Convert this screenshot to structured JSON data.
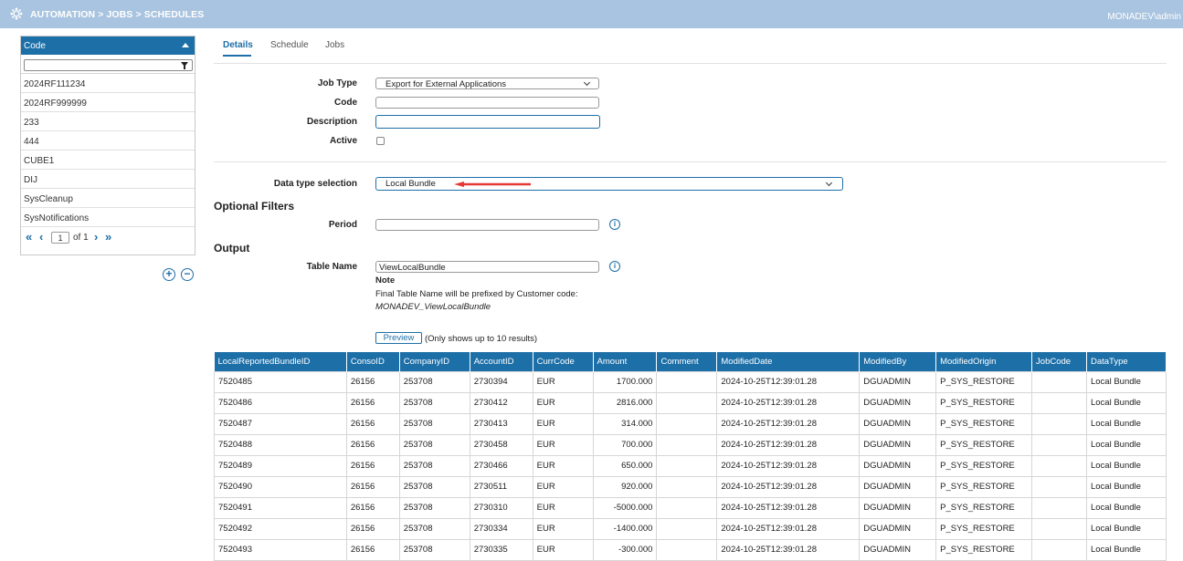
{
  "topbar": {
    "breadcrumb": "AUTOMATION > JOBS > SCHEDULES",
    "user": "MONADEV\\admin",
    "logo_icon": "gear-cluster-icon"
  },
  "sidebar": {
    "column_header": "Code",
    "filter_value": "",
    "items": [
      "2024RF111234",
      "2024RF999999",
      "233",
      "444",
      "CUBE1",
      "DIJ",
      "SysCleanup",
      "SysNotifications"
    ],
    "pager": {
      "current": "1",
      "of_label": "of",
      "total": "1"
    },
    "add_label": "+",
    "remove_label": "−"
  },
  "tabs": [
    {
      "label": "Details",
      "active": true
    },
    {
      "label": "Schedule",
      "active": false
    },
    {
      "label": "Jobs",
      "active": false
    }
  ],
  "form": {
    "job_type_label": "Job Type",
    "job_type_value": "Export for External Applications",
    "code_label": "Code",
    "code_value": "",
    "description_label": "Description",
    "description_value": "",
    "active_label": "Active",
    "active_checked": false,
    "data_type_label": "Data type selection",
    "data_type_value": "Local Bundle",
    "optional_filters_title": "Optional Filters",
    "period_label": "Period",
    "period_value": "",
    "output_title": "Output",
    "table_name_label": "Table Name",
    "table_name_value": "ViewLocalBundle",
    "note_title": "Note",
    "note_text": "Final Table Name will be prefixed by Customer code:",
    "note_example": "MONADEV_ViewLocalBundle",
    "preview_label": "Preview",
    "preview_note": "(Only shows up to 10 results)"
  },
  "colors": {
    "accent": "#1d6fa8",
    "topbar": "#a9c4e0",
    "arrow": "#e53935"
  },
  "table": {
    "columns": [
      "LocalReportedBundleID",
      "ConsoID",
      "CompanyID",
      "AccountID",
      "CurrCode",
      "Amount",
      "Comment",
      "ModifiedDate",
      "ModifiedBy",
      "ModifiedOrigin",
      "JobCode",
      "DataType"
    ],
    "rows": [
      [
        "7520485",
        "26156",
        "253708",
        "2730394",
        "EUR",
        "1700.000",
        "",
        "2024-10-25T12:39:01.28",
        "DGUADMIN",
        "P_SYS_RESTORE",
        "",
        "Local Bundle"
      ],
      [
        "7520486",
        "26156",
        "253708",
        "2730412",
        "EUR",
        "2816.000",
        "",
        "2024-10-25T12:39:01.28",
        "DGUADMIN",
        "P_SYS_RESTORE",
        "",
        "Local Bundle"
      ],
      [
        "7520487",
        "26156",
        "253708",
        "2730413",
        "EUR",
        "314.000",
        "",
        "2024-10-25T12:39:01.28",
        "DGUADMIN",
        "P_SYS_RESTORE",
        "",
        "Local Bundle"
      ],
      [
        "7520488",
        "26156",
        "253708",
        "2730458",
        "EUR",
        "700.000",
        "",
        "2024-10-25T12:39:01.28",
        "DGUADMIN",
        "P_SYS_RESTORE",
        "",
        "Local Bundle"
      ],
      [
        "7520489",
        "26156",
        "253708",
        "2730466",
        "EUR",
        "650.000",
        "",
        "2024-10-25T12:39:01.28",
        "DGUADMIN",
        "P_SYS_RESTORE",
        "",
        "Local Bundle"
      ],
      [
        "7520490",
        "26156",
        "253708",
        "2730511",
        "EUR",
        "920.000",
        "",
        "2024-10-25T12:39:01.28",
        "DGUADMIN",
        "P_SYS_RESTORE",
        "",
        "Local Bundle"
      ],
      [
        "7520491",
        "26156",
        "253708",
        "2730310",
        "EUR",
        "-5000.000",
        "",
        "2024-10-25T12:39:01.28",
        "DGUADMIN",
        "P_SYS_RESTORE",
        "",
        "Local Bundle"
      ],
      [
        "7520492",
        "26156",
        "253708",
        "2730334",
        "EUR",
        "-1400.000",
        "",
        "2024-10-25T12:39:01.28",
        "DGUADMIN",
        "P_SYS_RESTORE",
        "",
        "Local Bundle"
      ],
      [
        "7520493",
        "26156",
        "253708",
        "2730335",
        "EUR",
        "-300.000",
        "",
        "2024-10-25T12:39:01.28",
        "DGUADMIN",
        "P_SYS_RESTORE",
        "",
        "Local Bundle"
      ]
    ]
  }
}
